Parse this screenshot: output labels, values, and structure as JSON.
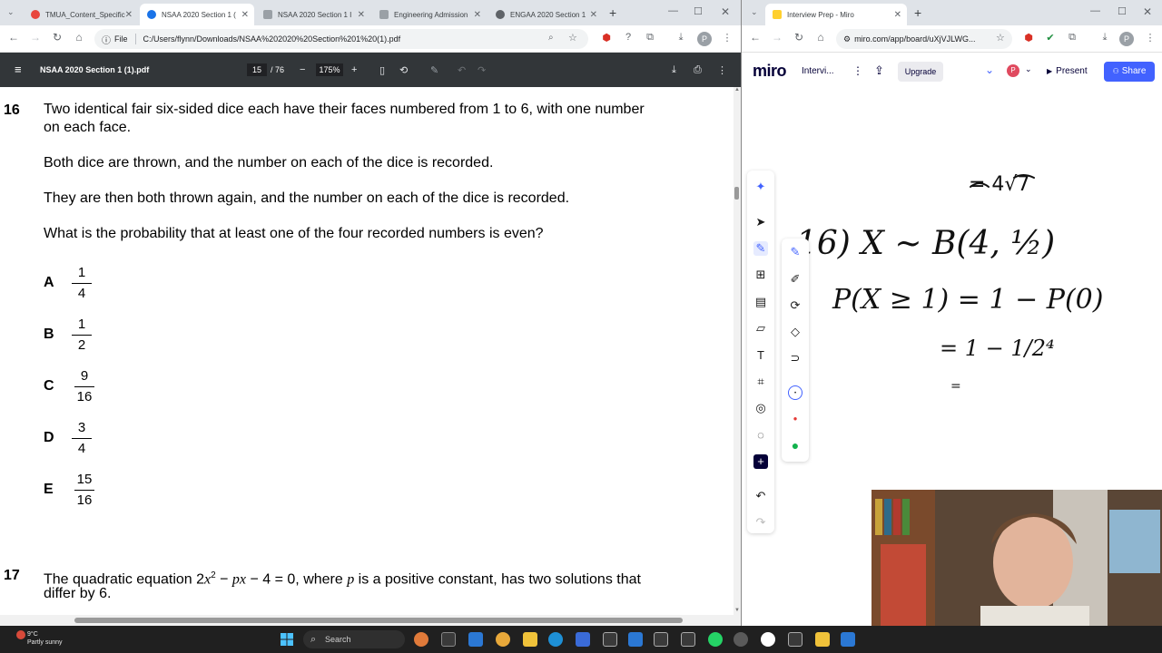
{
  "left_browser": {
    "tabs": [
      {
        "label": "TMUA_Content_Specific",
        "active": false,
        "color": "#e8453c"
      },
      {
        "label": "NSAA 2020 Section 1 (",
        "active": true,
        "color": "#1a73e8"
      },
      {
        "label": "NSAA 2020 Section 1 I",
        "active": false,
        "color": "#5f6368"
      },
      {
        "label": "Engineering Admission",
        "active": false,
        "color": "#5f6368"
      },
      {
        "label": "ENGAA 2020 Section 1",
        "active": false,
        "color": "#1a73e8"
      }
    ],
    "address_scheme": "File",
    "address_url": "C:/Users/flynn/Downloads/NSAA%202020%20Section%201%20(1).pdf",
    "avatar_letter": "P"
  },
  "pdf_viewer": {
    "file_title": "NSAA 2020 Section 1 (1).pdf",
    "current_page": "15",
    "total_pages": "/ 76",
    "zoom": "175%"
  },
  "question16": {
    "number": "16",
    "line1": "Two identical fair six-sided dice each have their faces numbered from 1 to 6, with one number",
    "line2": "on each face.",
    "para2": "Both dice are thrown, and the number on each of the dice is recorded.",
    "para3": "They are then both thrown again, and the number on each of the dice is recorded.",
    "question": "What is the probability that at least one of the four recorded numbers is even?",
    "options": [
      {
        "letter": "A",
        "num": "1",
        "den": "4"
      },
      {
        "letter": "B",
        "num": "1",
        "den": "2"
      },
      {
        "letter": "C",
        "num": "9",
        "den": "16"
      },
      {
        "letter": "D",
        "num": "3",
        "den": "4"
      },
      {
        "letter": "E",
        "num": "15",
        "den": "16"
      }
    ]
  },
  "question17": {
    "number": "17",
    "line1_a": "The quadratic equation 2",
    "line1_x": "x",
    "line1_sup": "2",
    "line1_b": " − ",
    "line1_px": "px",
    "line1_c": " − 4 = 0, where ",
    "line1_p": "p",
    "line1_d": " is a positive constant, has two solutions that",
    "line2": "differ by 6."
  },
  "right_browser": {
    "tab_label": "Interview Prep - Miro",
    "address_url": "miro.com/app/board/uXjVJLWG...",
    "avatar_letter": "P"
  },
  "miro": {
    "logo": "miro",
    "board_name": "Intervi...",
    "upgrade_label": "Upgrade",
    "present_label": "Present",
    "share_label": "Share",
    "user_initial": "P",
    "handwriting": {
      "top_fragment": "= 4√7",
      "line1": "16) X ~ B(4, ½)",
      "line2": "P(X ≥ 1) = 1 − P(0)",
      "line3": "= 1 − 1/2⁴",
      "line4": "="
    }
  },
  "taskbar": {
    "temperature": "9°C",
    "weather": "Partly sunny",
    "search_placeholder": "Search"
  }
}
